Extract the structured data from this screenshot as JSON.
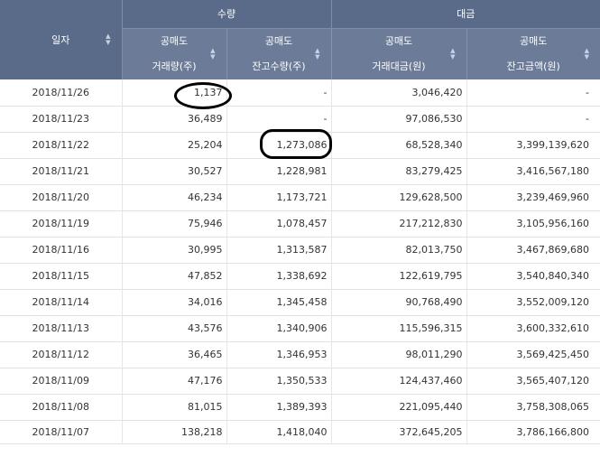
{
  "header": {
    "date_label": "일자",
    "group_qty": "수량",
    "group_amt": "대금",
    "sub": [
      {
        "line1": "공매도",
        "line2": "거래량(주)"
      },
      {
        "line1": "공매도",
        "line2": "잔고수량(주)"
      },
      {
        "line1": "공매도",
        "line2": "거래대금(원)"
      },
      {
        "line1": "공매도",
        "line2": "잔고금액(원)"
      }
    ]
  },
  "rows": [
    {
      "date": "2018/11/26",
      "vol": "1,137",
      "bal_qty": "-",
      "trade_amt": "3,046,420",
      "bal_amt": "-"
    },
    {
      "date": "2018/11/23",
      "vol": "36,489",
      "bal_qty": "-",
      "trade_amt": "97,086,530",
      "bal_amt": "-"
    },
    {
      "date": "2018/11/22",
      "vol": "25,204",
      "bal_qty": "1,273,086",
      "trade_amt": "68,528,340",
      "bal_amt": "3,399,139,620"
    },
    {
      "date": "2018/11/21",
      "vol": "30,527",
      "bal_qty": "1,228,981",
      "trade_amt": "83,279,425",
      "bal_amt": "3,416,567,180"
    },
    {
      "date": "2018/11/20",
      "vol": "46,234",
      "bal_qty": "1,173,721",
      "trade_amt": "129,628,500",
      "bal_amt": "3,239,469,960"
    },
    {
      "date": "2018/11/19",
      "vol": "75,946",
      "bal_qty": "1,078,457",
      "trade_amt": "217,212,830",
      "bal_amt": "3,105,956,160"
    },
    {
      "date": "2018/11/16",
      "vol": "30,995",
      "bal_qty": "1,313,587",
      "trade_amt": "82,013,750",
      "bal_amt": "3,467,869,680"
    },
    {
      "date": "2018/11/15",
      "vol": "47,852",
      "bal_qty": "1,338,692",
      "trade_amt": "122,619,795",
      "bal_amt": "3,540,840,340"
    },
    {
      "date": "2018/11/14",
      "vol": "34,016",
      "bal_qty": "1,345,458",
      "trade_amt": "90,768,490",
      "bal_amt": "3,552,009,120"
    },
    {
      "date": "2018/11/13",
      "vol": "43,576",
      "bal_qty": "1,340,906",
      "trade_amt": "115,596,315",
      "bal_amt": "3,600,332,610"
    },
    {
      "date": "2018/11/12",
      "vol": "36,465",
      "bal_qty": "1,346,953",
      "trade_amt": "98,011,290",
      "bal_amt": "3,569,425,450"
    },
    {
      "date": "2018/11/09",
      "vol": "47,176",
      "bal_qty": "1,350,533",
      "trade_amt": "124,437,460",
      "bal_amt": "3,565,407,120"
    },
    {
      "date": "2018/11/08",
      "vol": "81,015",
      "bal_qty": "1,389,393",
      "trade_amt": "221,095,440",
      "bal_amt": "3,758,308,065"
    },
    {
      "date": "2018/11/07",
      "vol": "138,218",
      "bal_qty": "1,418,040",
      "trade_amt": "372,645,205",
      "bal_amt": "3,786,166,800"
    }
  ],
  "sort_icon": "sort-up-down-icon",
  "colors": {
    "header_bg": "#5a6b89",
    "subheader_bg": "#6c7c98",
    "annotation": "#000000"
  }
}
